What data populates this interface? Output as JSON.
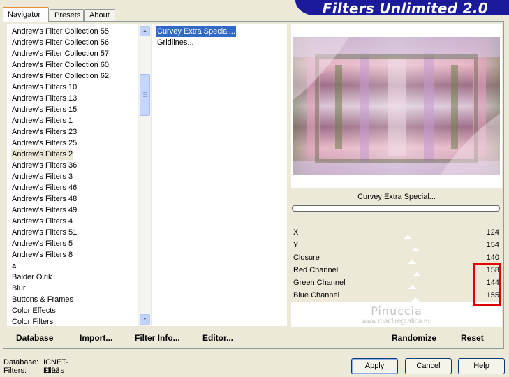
{
  "tabs": [
    {
      "label": "Navigator",
      "active": true
    },
    {
      "label": "Presets",
      "active": false
    },
    {
      "label": "About",
      "active": false
    }
  ],
  "banner": {
    "title": "Filters Unlimited 2.0",
    "color": "#1a1a9a"
  },
  "filter_list": {
    "items": [
      "Andrew's Filter Collection 55",
      "Andrew's Filter Collection 56",
      "Andrew's Filter Collection 57",
      "Andrew's Filter Collection 60",
      "Andrew's Filter Collection 62",
      "Andrew's Filters 10",
      "Andrew's Filters 13",
      "Andrew's Filters 15",
      "Andrew's Filters 1",
      "Andrew's Filters 23",
      "Andrew's Filters 25",
      "Andrew's Filters 2",
      "Andrew's Filters 36",
      "Andrew's Filters 3",
      "Andrew's Filters 46",
      "Andrew's Filters 48",
      "Andrew's Filters 49",
      "Andrew's Filters 4",
      "Andrew's Filters 51",
      "Andrew's Filters 5",
      "Andrew's Filters 8",
      "a",
      "Balder Olrik",
      "Blur",
      "Buttons & Frames",
      "Color Effects",
      "Color Filters"
    ],
    "selected": "Andrew's Filters 2"
  },
  "effects_list": {
    "items": [
      "Curvey Extra Special...",
      "Gridlines..."
    ],
    "selected": "Curvey Extra Special..."
  },
  "preview": {
    "effect_name": "Curvey Extra Special..."
  },
  "parameters": [
    {
      "label": "X",
      "value": "124",
      "fraction": 0.486
    },
    {
      "label": "Y",
      "value": "154",
      "fraction": 0.604
    },
    {
      "label": "Closure",
      "value": "140",
      "fraction": 0.549
    },
    {
      "label": "Red Channel",
      "value": "158",
      "fraction": 0.62
    },
    {
      "label": "Green Channel",
      "value": "144",
      "fraction": 0.565
    },
    {
      "label": "Blue Channel",
      "value": "155",
      "fraction": 0.608
    }
  ],
  "watermark": {
    "name": "Pinuccia",
    "site": "www.maidiregrafica.eu"
  },
  "left_buttons": {
    "database": "Database",
    "import": "Import...",
    "filter_info": "Filter Info...",
    "editor": "Editor..."
  },
  "right_buttons": {
    "randomize": "Randomize",
    "reset": "Reset"
  },
  "status": {
    "database_label": "Database:",
    "database_value": "ICNET-Filters",
    "filters_label": "Filters:",
    "filters_value": "1193"
  },
  "dialog_buttons": {
    "apply": "Apply",
    "cancel": "Cancel",
    "help": "Help"
  },
  "icons": [
    "scroll-up-arrow-icon",
    "scroll-down-arrow-icon"
  ],
  "highlight_color": "#e00000"
}
